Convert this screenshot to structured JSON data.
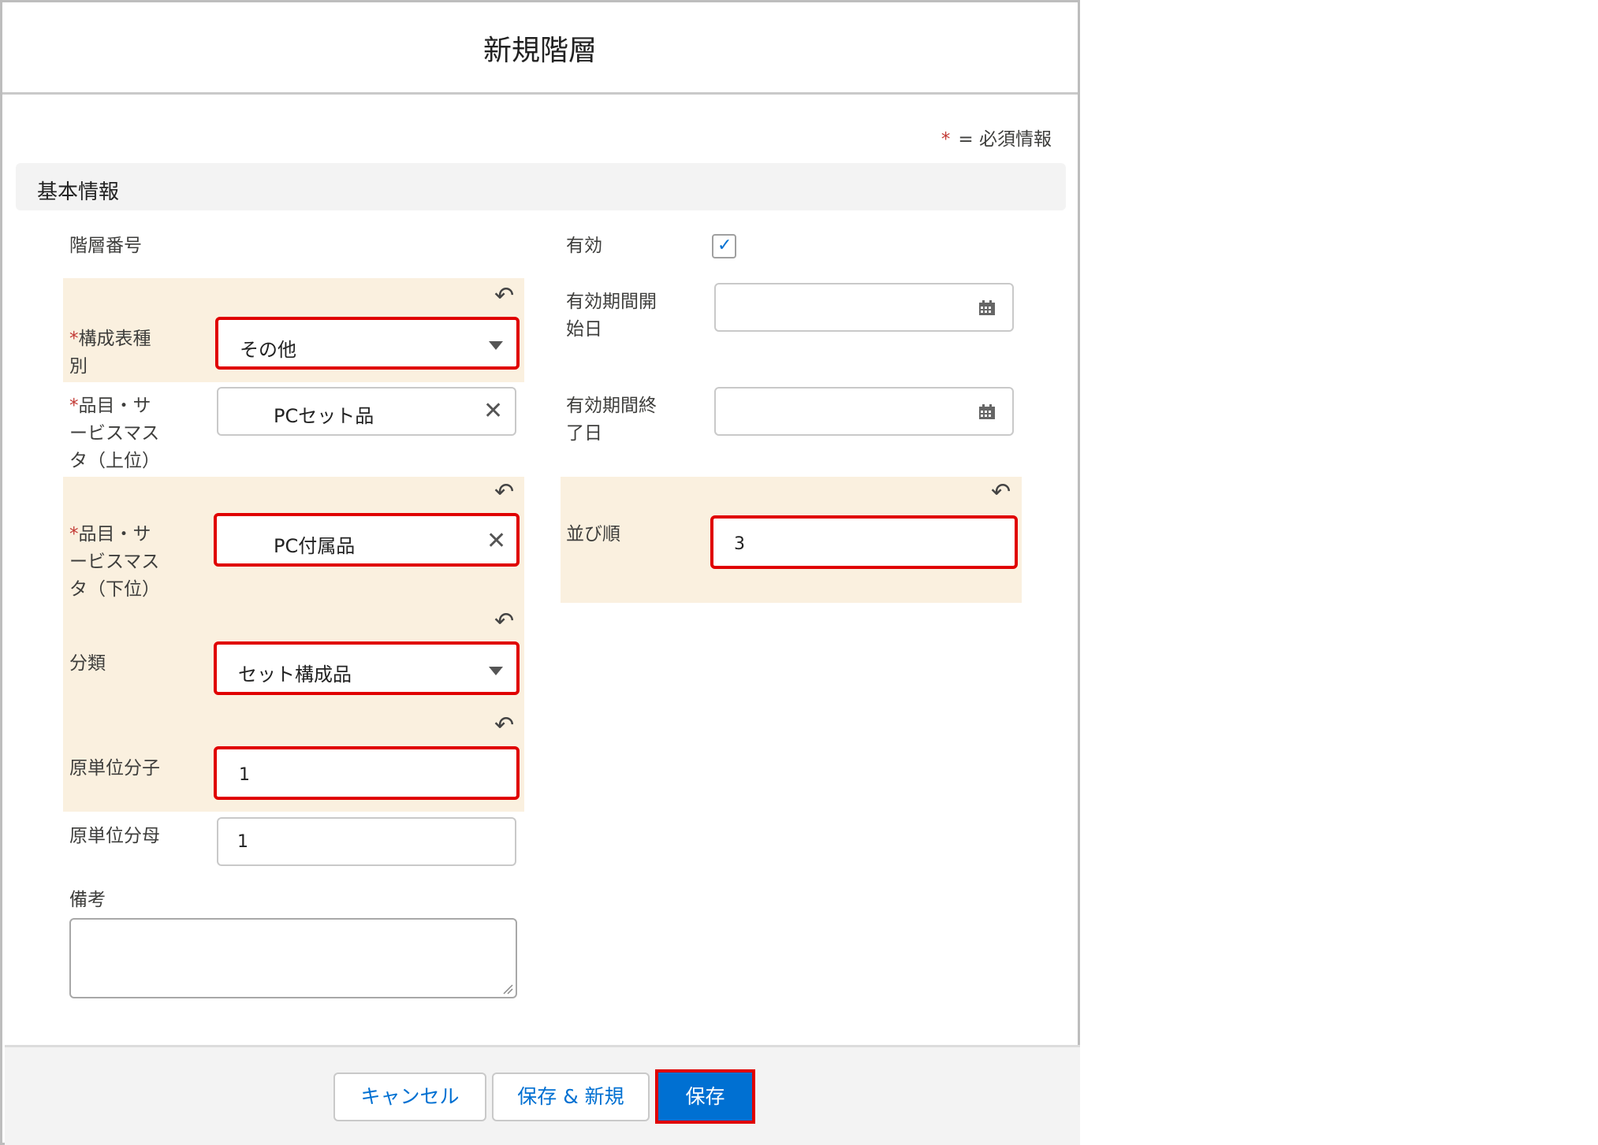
{
  "dialog": {
    "title": "新規階層",
    "required_star": "*",
    "required_note": "= 必須情報"
  },
  "section": {
    "label": "基本情報"
  },
  "fields": {
    "hierarchy_number": {
      "label": "階層番号"
    },
    "composition_type": {
      "star": "*",
      "label_line1": "構成表種",
      "label_line2": "別",
      "value": "その他"
    },
    "parent_item": {
      "star": "*",
      "label_line1": "品目・サ",
      "label_line2": "ービスマス",
      "label_line3": "タ（上位）",
      "value": "PCセット品"
    },
    "child_item": {
      "star": "*",
      "label_line1": "品目・サ",
      "label_line2": "ービスマス",
      "label_line3": "タ（下位）",
      "value": "PC付属品"
    },
    "classification": {
      "label": "分類",
      "value": "セット構成品"
    },
    "unit_numerator": {
      "label": "原単位分子",
      "value": "1"
    },
    "unit_denominator": {
      "label": "原単位分母",
      "value": "1"
    },
    "remarks": {
      "label": "備考",
      "value": ""
    },
    "active": {
      "label": "有効",
      "checked": true
    },
    "valid_start": {
      "label_line1": "有効期間開",
      "label_line2": "始日",
      "value": ""
    },
    "valid_end": {
      "label_line1": "有効期間終",
      "label_line2": "了日",
      "value": ""
    },
    "sort_order": {
      "label": "並び順",
      "value": "3"
    }
  },
  "icons": {
    "undo": "↶",
    "clear": "✕",
    "check": "✓"
  },
  "footer": {
    "cancel_label": "キャンセル",
    "save_new_label": "保存 & 新規",
    "save_label": "保存"
  },
  "colors": {
    "accent": "#0070d2",
    "highlight": "#faf0df",
    "annotation_red": "#e00000",
    "required_star": "#c23934"
  }
}
